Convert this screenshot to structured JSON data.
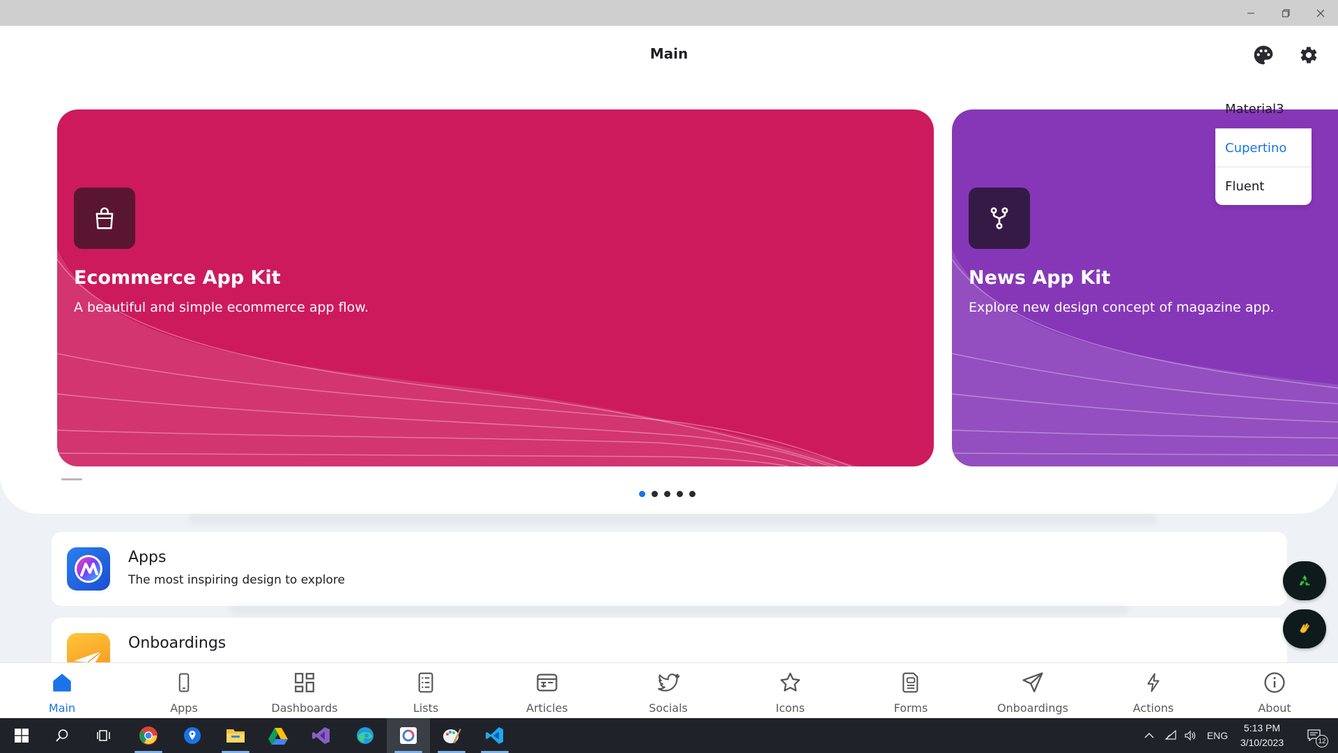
{
  "window": {
    "minimize": "–",
    "restore": "❐",
    "close": "✕"
  },
  "header": {
    "title": "Main",
    "palette_icon": "palette-icon",
    "settings_icon": "gear-icon"
  },
  "theme_menu": {
    "options": [
      "Material3",
      "Cupertino",
      "Fluent"
    ],
    "highlighted": "Cupertino"
  },
  "carousel": {
    "slides": [
      {
        "title": "Ecommerce App Kit",
        "description": "A beautiful and simple ecommerce app flow.",
        "icon": "shopping-bag-icon",
        "color": "#cd1a5d",
        "badge_color": "#5a1630"
      },
      {
        "title": "News App Kit",
        "description": "Explore new design concept of magazine app.",
        "icon": "fork-icon",
        "color": "#8537b8",
        "badge_color": "#351a46"
      }
    ],
    "page_count": 5,
    "active_page": 1
  },
  "list": [
    {
      "title": "Apps",
      "subtitle": "The most inspiring design to explore",
      "icon": "apps-logo-icon"
    },
    {
      "title": "Onboardings",
      "subtitle": "",
      "icon": "paper-plane-icon"
    }
  ],
  "fabs": [
    {
      "icon": "recycle-icon"
    },
    {
      "icon": "clapping-hands-icon"
    }
  ],
  "nav": {
    "items": [
      {
        "label": "Main",
        "icon": "home-icon",
        "active": true
      },
      {
        "label": "Apps",
        "icon": "phone-icon"
      },
      {
        "label": "Dashboards",
        "icon": "dashboard-icon"
      },
      {
        "label": "Lists",
        "icon": "list-icon"
      },
      {
        "label": "Articles",
        "icon": "article-icon"
      },
      {
        "label": "Socials",
        "icon": "twitter-icon"
      },
      {
        "label": "Icons",
        "icon": "star-icon"
      },
      {
        "label": "Forms",
        "icon": "form-icon"
      },
      {
        "label": "Onboardings",
        "icon": "paper-plane-icon"
      },
      {
        "label": "Actions",
        "icon": "lightning-icon"
      },
      {
        "label": "About",
        "icon": "info-icon"
      }
    ]
  },
  "taskbar": {
    "apps": [
      "windows-start-icon",
      "search-icon",
      "task-view-icon",
      "chrome-icon",
      "maps-icon",
      "file-explorer-icon",
      "google-drive-icon",
      "visual-studio-icon",
      "edge-icon",
      "app-preview-icon",
      "paint-icon",
      "vscode-icon"
    ],
    "language": "ENG",
    "time": "5:13 PM",
    "date": "3/10/2023",
    "notification_count": "12"
  },
  "colors": {
    "accent": "#1a73e8",
    "ecommerce": "#cd1a5d",
    "news": "#8537b8"
  }
}
